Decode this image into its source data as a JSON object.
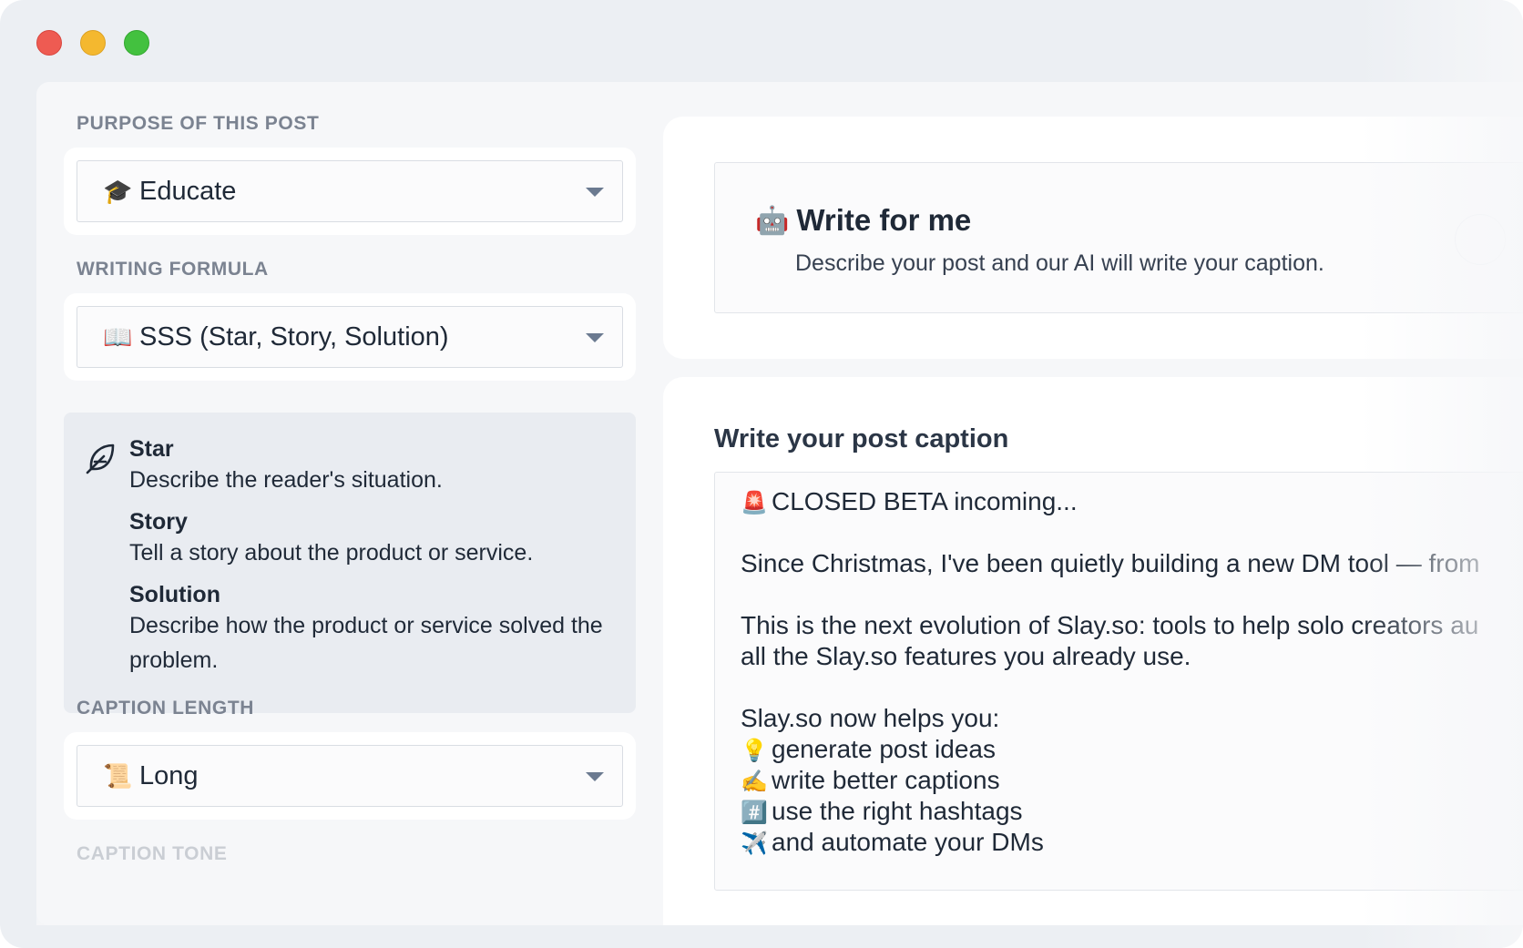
{
  "left": {
    "purpose": {
      "label": "PURPOSE OF THIS POST",
      "emoji": "🎓",
      "value": "Educate"
    },
    "formula": {
      "label": "WRITING FORMULA",
      "emoji": "📖",
      "value": "SSS (Star, Story, Solution)"
    },
    "steps": [
      {
        "title": "Star",
        "desc": "Describe the reader's situation."
      },
      {
        "title": "Story",
        "desc": "Tell a story about the product or service."
      },
      {
        "title": "Solution",
        "desc": "Describe how the product or service solved the problem."
      }
    ],
    "length": {
      "label": "CAPTION LENGTH",
      "emoji": "📜",
      "value": "Long"
    },
    "tone": {
      "label": "CAPTION TONE"
    }
  },
  "write_for_me": {
    "emoji": "🤖",
    "title": "Write for me",
    "desc": "Describe your post and our AI will write your caption."
  },
  "caption": {
    "heading": "Write your post caption",
    "lines": [
      {
        "emoji": "🚨",
        "text": "CLOSED BETA incoming..."
      },
      {
        "emoji": "",
        "text": "Since Christmas, I've been quietly building a new DM tool — from"
      },
      {
        "emoji": "",
        "text": "This is the next evolution of Slay.so: tools to help solo creators au"
      },
      {
        "emoji": "",
        "text": "all the Slay.so features you already use."
      },
      {
        "emoji": "",
        "text": "Slay.so now helps you:"
      },
      {
        "emoji": "💡",
        "text": "generate post ideas"
      },
      {
        "emoji": "✍️",
        "text": "write better captions"
      },
      {
        "emoji": "#️⃣",
        "text": "use the right hashtags"
      },
      {
        "emoji": "✈️",
        "text": "and automate your DMs"
      }
    ]
  },
  "icons": {
    "feather": "feather-icon",
    "caret": "chevron-down-icon"
  }
}
